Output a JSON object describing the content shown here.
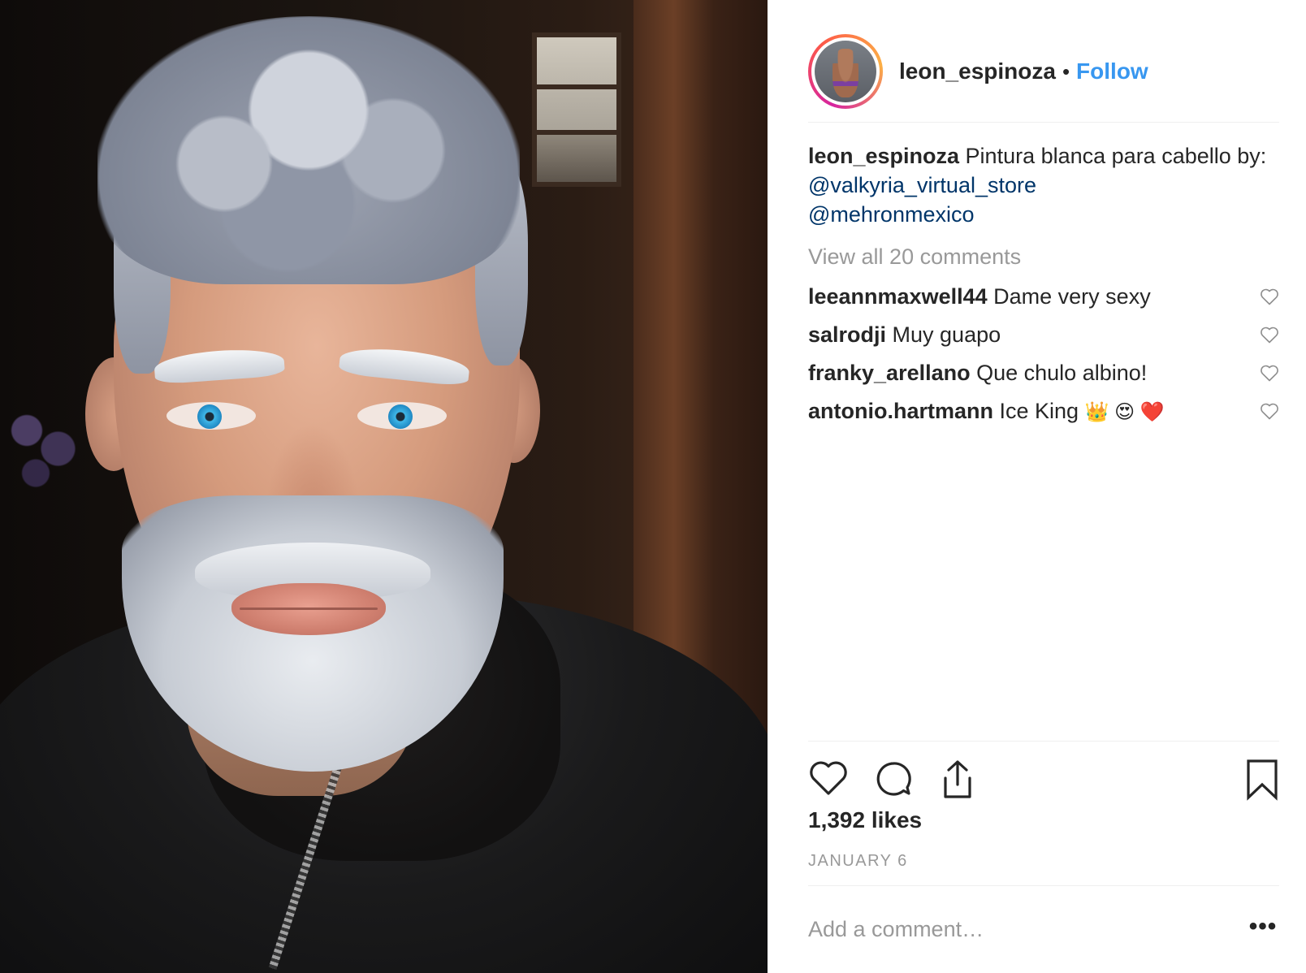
{
  "post": {
    "username": "leon_espinoza",
    "separator": "•",
    "follow_label": "Follow",
    "caption": {
      "username": "leon_espinoza",
      "text_before": " Pintura blanca para cabello by: ",
      "mention1": "@valkyria_virtual_store",
      "mention2": "@mehronmexico"
    },
    "view_all_comments": "View all 20 comments",
    "comments": [
      {
        "user": "leeannmaxwell44",
        "text": " Dame very sexy"
      },
      {
        "user": "salrodji",
        "text": " Muy guapo"
      },
      {
        "user": "franky_arellano",
        "text": " Que chulo albino!"
      },
      {
        "user": "antonio.hartmann",
        "text": " Ice King ",
        "emojis": "👑 😍 ❤️"
      }
    ],
    "likes": "1,392 likes",
    "date": "JANUARY 6",
    "add_comment_placeholder": "Add a comment…",
    "more_label": "•••"
  },
  "icons": {
    "like": "heart-icon",
    "comment": "comment-bubble-icon",
    "share": "share-icon",
    "save": "bookmark-icon",
    "comment_like": "small-heart-icon"
  },
  "colors": {
    "follow": "#3897f0",
    "mention": "#003569",
    "muted": "#999999",
    "text": "#262626"
  }
}
